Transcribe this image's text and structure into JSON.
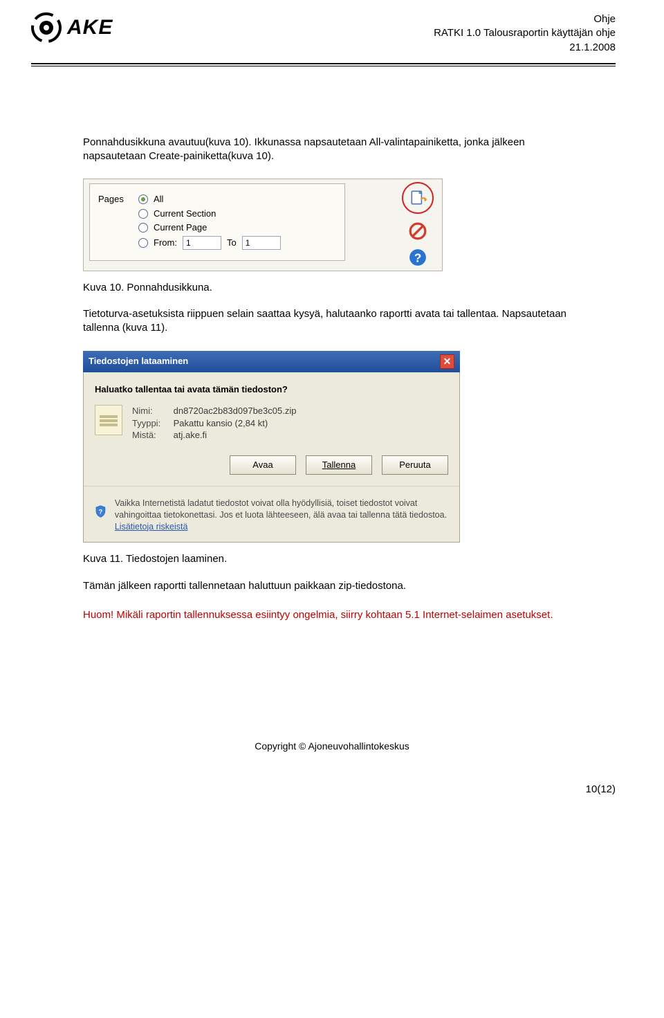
{
  "header": {
    "brand": "AKE",
    "line1": "Ohje",
    "line2": "RATKI 1.0 Talousraportin käyttäjän ohje",
    "line3": "21.1.2008"
  },
  "body": {
    "para1": "Ponnahdusikkuna avautuu(kuva 10). Ikkunassa napsautetaan All-valintapainiketta, jonka jälkeen napsautetaan Create-painiketta(kuva 10).",
    "caption10": "Kuva 10. Ponnahdusikkuna.",
    "para2": "Tietoturva-asetuksista riippuen selain saattaa kysyä, halutaanko raportti avata tai tallentaa. Napsautetaan tallenna (kuva 11).",
    "caption11": "Kuva 11. Tiedostojen laaminen.",
    "para3": "Tämän jälkeen raportti tallennetaan haluttuun paikkaan zip-tiedostona.",
    "warn": "Huom! Mikäli raportin tallennuksessa esiintyy ongelmia, siirry kohtaan 5.1 Internet-selaimen asetukset."
  },
  "pages_panel": {
    "label": "Pages",
    "options": {
      "all": "All",
      "current_section": "Current Section",
      "current_page": "Current Page",
      "from_label": "From:",
      "to_label": "To"
    },
    "from_value": "1",
    "to_value": "1"
  },
  "dialog": {
    "title": "Tiedostojen lataaminen",
    "question": "Haluatko tallentaa tai avata tämän tiedoston?",
    "name_label": "Nimi:",
    "name_value": "dn8720ac2b83d097be3c05.zip",
    "type_label": "Tyyppi:",
    "type_value": "Pakattu kansio (2,84 kt)",
    "from_label": "Mistä:",
    "from_value": "atj.ake.fi",
    "buttons": {
      "open": "Avaa",
      "save": "Tallenna",
      "cancel": "Peruuta"
    },
    "warn_text": "Vaikka Internetistä ladatut tiedostot voivat olla hyödyllisiä, toiset tiedostot voivat vahingoittaa tietokonettasi. Jos et luota lähteeseen, älä avaa tai tallenna tätä tiedostoa. ",
    "warn_link": "Lisätietoja riskeistä"
  },
  "footer": {
    "copyright": "Copyright © Ajoneuvohallintokeskus",
    "page": "10(12)"
  }
}
